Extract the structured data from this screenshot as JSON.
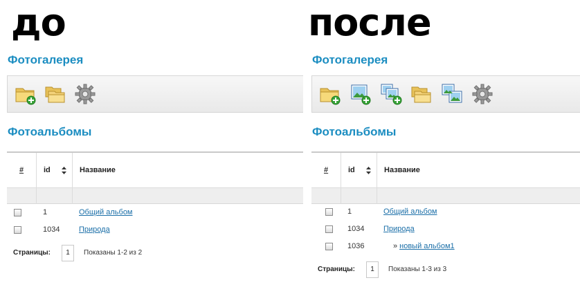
{
  "left": {
    "heading": "до",
    "gallery_title": "Фотогалерея",
    "toolbar_icons": [
      "folder-add-icon",
      "folders-icon",
      "gear-icon"
    ],
    "albums_title": "Фотоальбомы",
    "columns": {
      "hash": "#",
      "id": "id",
      "name": "Название"
    },
    "rows": [
      {
        "id": "1",
        "name": "Общий альбом",
        "prefix": ""
      },
      {
        "id": "1034",
        "name": "Природа",
        "prefix": ""
      }
    ],
    "pager": {
      "label": "Страницы:",
      "current": "1",
      "info": "Показаны 1-2 из 2"
    }
  },
  "right": {
    "heading": "после",
    "gallery_title": "Фотогалерея",
    "toolbar_icons": [
      "folder-add-icon",
      "photo-add-icon",
      "photos-add-icon",
      "folders-icon",
      "photos-icon",
      "gear-icon"
    ],
    "albums_title": "Фотоальбомы",
    "columns": {
      "hash": "#",
      "id": "id",
      "name": "Название"
    },
    "rows": [
      {
        "id": "1",
        "name": "Общий альбом",
        "prefix": ""
      },
      {
        "id": "1034",
        "name": "Природа",
        "prefix": ""
      },
      {
        "id": "1036",
        "name": "новый альбом1",
        "prefix": "»"
      }
    ],
    "pager": {
      "label": "Страницы:",
      "current": "1",
      "info": "Показаны 1-3 из 3"
    }
  },
  "colors": {
    "accent": "#1b8dc1",
    "link": "#1b6fa8"
  }
}
